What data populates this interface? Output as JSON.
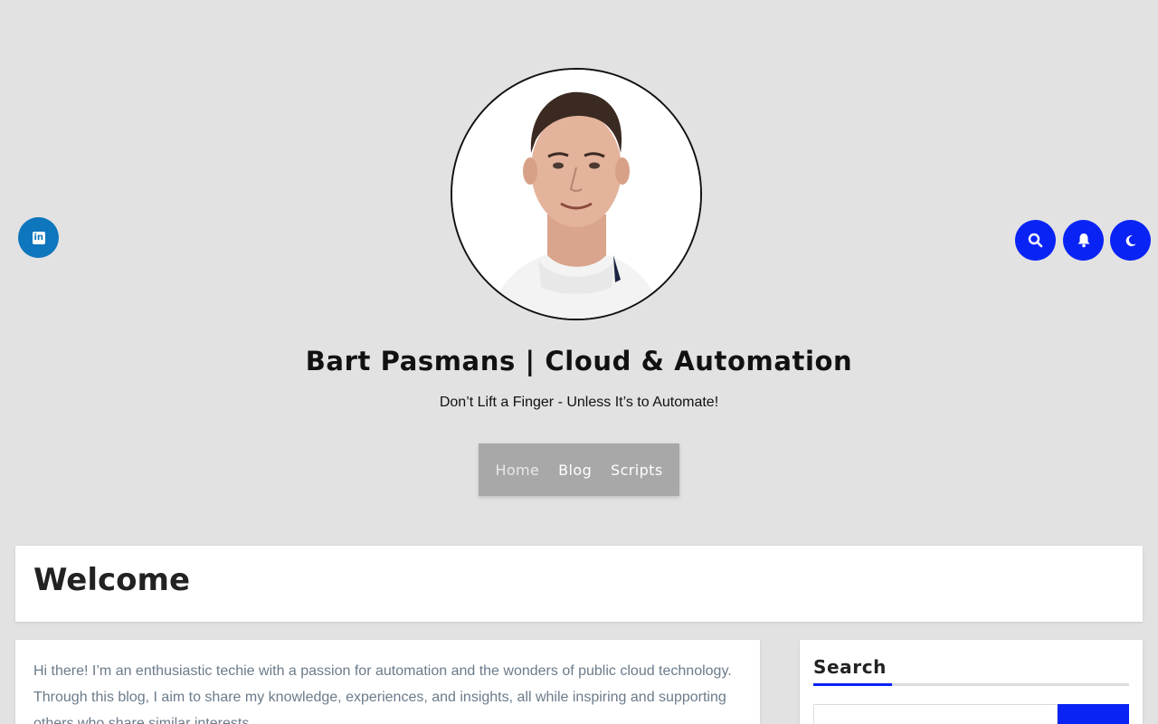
{
  "header": {
    "site_title": "Bart Pasmans | Cloud & Automation",
    "tagline": "Don’t Lift a Finger - Unless It’s to Automate!",
    "avatar_alt": "Portrait of Bart Pasmans"
  },
  "social": {
    "icon": "linkedin-icon",
    "color": "#0e76bd"
  },
  "tools": {
    "accent": "#0a23f5",
    "search_icon": "search-icon",
    "notification_icon": "bell-icon",
    "dark_mode_icon": "moon-icon"
  },
  "nav": {
    "items": [
      {
        "label": "Home"
      },
      {
        "label": "Blog"
      },
      {
        "label": "Scripts"
      }
    ]
  },
  "page": {
    "title": "Welcome"
  },
  "content": {
    "intro": "Hi there! I’m an enthusiastic techie with a passion for automation and the wonders of public cloud technology. Through this blog, I aim to share my knowledge, experiences, and insights, all while inspiring and supporting others who share similar interests."
  },
  "sidebar": {
    "search_title": "Search",
    "search_placeholder": "",
    "search_button_label": ""
  }
}
